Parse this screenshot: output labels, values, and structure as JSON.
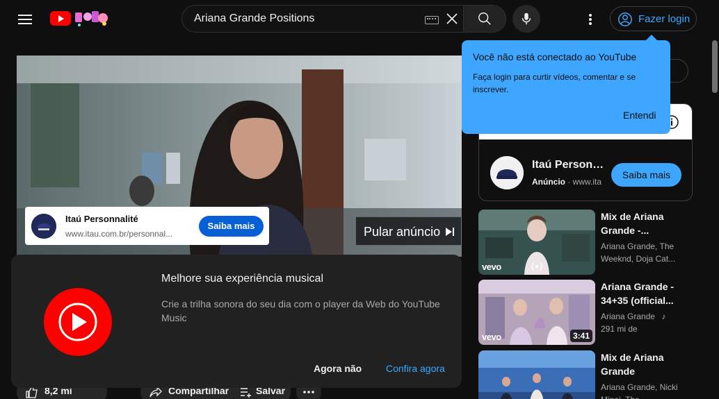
{
  "header": {
    "search_query": "Ariana Grande Positions",
    "login_label": "Fazer login"
  },
  "video": {
    "ad_card": {
      "title": "Itaú Personnalité",
      "url": "www.itau.com.br/personnal...",
      "cta": "Saiba mais"
    },
    "skip_label": "Pular anúncio"
  },
  "promo": {
    "title": "Melhore sua experiência musical",
    "description": "Crie a trilha sonora do seu dia com o player da Web do YouTube Music",
    "later": "Agora não",
    "check": "Confira agora"
  },
  "actions": {
    "likes": "8,2 mi",
    "share": "Compartilhar",
    "save": "Salvar"
  },
  "tooltip": {
    "title": "Você não está conectado ao YouTube",
    "description": "Faça login para curtir vídeos, comentar e se inscrever.",
    "button": "Entendi"
  },
  "sidebar_ad": {
    "title": "Itaú Personnalité",
    "badge": "Anúncio",
    "url": "www.ita",
    "cta": "Saiba mais"
  },
  "recommendations": [
    {
      "title": "Mix de Ariana Grande -...",
      "meta": "Ariana Grande, The Weeknd, Doja Cat...",
      "badge": "vevo",
      "duration": ""
    },
    {
      "title": "Ariana Grande - 34+35 (official...",
      "meta": "Ariana Grande",
      "meta2": "291 mi de",
      "badge": "vevo",
      "duration": "3:41"
    },
    {
      "title": "Mix de Ariana Grande",
      "meta": "Ariana Grande, Nicki Minaj, The",
      "badge": "",
      "duration": ""
    }
  ],
  "colors": {
    "accent": "#3ea6ff",
    "youtube_red": "#ff0000",
    "background": "#0f0f0f"
  }
}
